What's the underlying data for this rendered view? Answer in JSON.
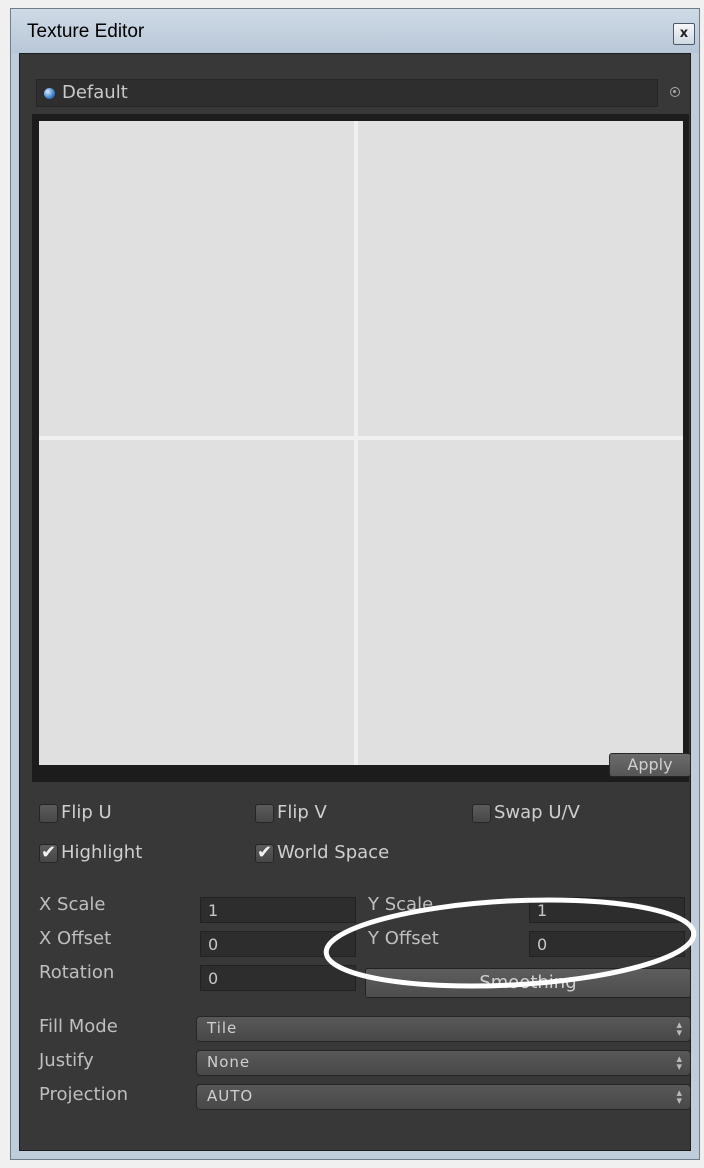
{
  "window": {
    "title": "Texture Editor",
    "close_glyph": "x"
  },
  "texture": {
    "name": "Default",
    "picker_icon": "object-picker-icon"
  },
  "preview": {
    "apply_label": "Apply"
  },
  "options": {
    "flip_u": {
      "label": "Flip U",
      "checked": false
    },
    "flip_v": {
      "label": "Flip V",
      "checked": false
    },
    "swap_uv": {
      "label": "Swap U/V",
      "checked": false
    },
    "highlight": {
      "label": "Highlight",
      "checked": true
    },
    "world_space": {
      "label": "World Space",
      "checked": true
    }
  },
  "transform": {
    "x_scale_label": "X Scale",
    "x_scale": "1",
    "y_scale_label": "Y Scale",
    "y_scale": "1",
    "x_offset_label": "X Offset",
    "x_offset": "0",
    "y_offset_label": "Y Offset",
    "y_offset": "0",
    "rotation_label": "Rotation",
    "rotation": "0"
  },
  "smoothing_label": "Smoothing",
  "fill_mode": {
    "label": "Fill Mode",
    "value": "Tile"
  },
  "justify": {
    "label": "Justify",
    "value": "None"
  },
  "projection": {
    "label": "Projection",
    "value": "AUTO"
  },
  "colors": {
    "panel": "#383838",
    "annotation_ellipse": "#ffffff"
  }
}
